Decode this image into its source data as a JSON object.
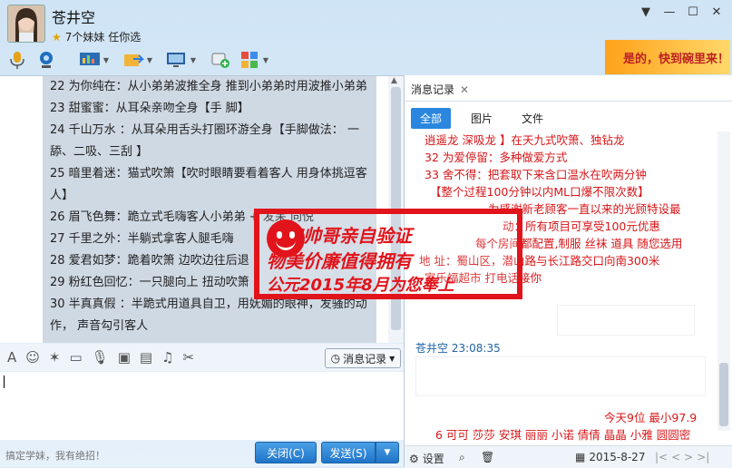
{
  "window": {
    "contact_name": "苍井空",
    "signature": "7个妹妹 任你选"
  },
  "ad": {
    "text": "是的，快到碗里来！"
  },
  "chat": {
    "lines": [
      "22 为你纯在：从小弟弟波推全身 推到小弟弟时用波推小弟弟",
      "23 甜蜜蜜：从耳朵亲吻全身【手 脚】",
      "24 千山万水 ：从耳朵用舌头打圈环游全身【手脚做法： 一舔、二吸、三刮 】",
      "25 暗里着迷：猫式吹箫【吹时眼睛要看着客人 用身体挑逗客人】",
      "26 眉飞色舞：跪立式毛嗨客人小弟弟 + 发呆 向悦",
      "27 千里之外：半躺式拿客人腿毛嗨",
      "28 爱君如梦：跪着吹箫 边吹边往后退",
      "29 粉红色回忆：一只腿向上 扭动吹箫",
      "30 半真真假 ：半跪式用道具自卫，用妩媚的眼神，发骚的动作， 声音勾引客人"
    ]
  },
  "input": {
    "history_button": "消息记录",
    "footer": "搞定学妹，我有绝招！",
    "close_label": "关闭(C)",
    "send_label": "发送(S)"
  },
  "history": {
    "tab_label": "消息记录",
    "filters": [
      "全部",
      "图片",
      "文件"
    ],
    "lines": [
      "逍遥龙 深吸龙 】在天九式吹箫、独钻龙",
      "32 为爱停留：多种做爱方式",
      "33 舍不得：把套取下来含口温水在吹两分钟",
      "【整个过程100分钟以内ML口爆不限次数】",
      "",
      "为感谢新老顾客一直以来的光顾特设最",
      "动：所有项目可享受100元优惠",
      "每个房间都配置,制服 丝袜 道具 随您选用",
      "",
      "地   址：蜀山区，潜山路与长江路交口向南300米",
      "家乐福超市 打电话接你"
    ],
    "sender": "苍井空 23:08:35",
    "bottom_lines": [
      "今天9位 最小97.9",
      "6 可可 莎莎 安琪 丽丽 小诺 倩倩 晶晶 小雅 圆圆密"
    ],
    "settings_label": "设置",
    "date": "2015-8-27"
  },
  "stamp": {
    "line1": "小狼帅哥亲自验证",
    "line2": "物美价廉值得拥有",
    "line3": "公元2015年8月为您奉上"
  }
}
